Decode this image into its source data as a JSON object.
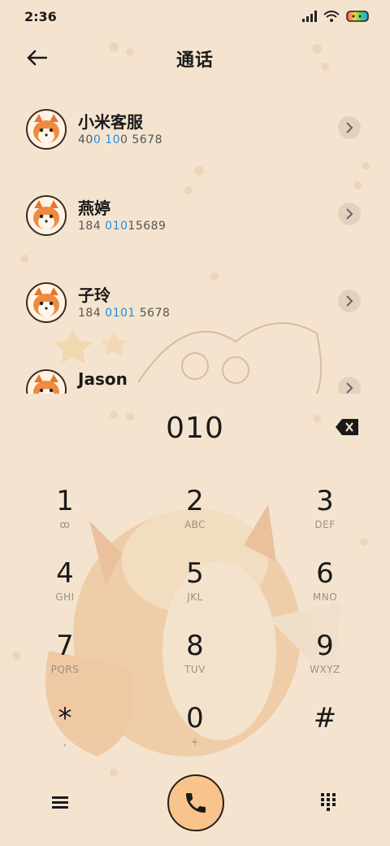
{
  "status": {
    "time": "2:36"
  },
  "header": {
    "title": "通话"
  },
  "contacts": [
    {
      "name": "小米客服",
      "num_pre": "40",
      "num_hl": "0 10",
      "num_post": "0 5678"
    },
    {
      "name": "燕婷",
      "num_pre": "184 ",
      "num_hl": "010",
      "num_post": "15689"
    },
    {
      "name": "子玲",
      "num_pre": "184 ",
      "num_hl": "0101",
      "num_post": " 5678"
    },
    {
      "name": "Jason",
      "num_pre": "",
      "num_hl": "",
      "num_post": ""
    }
  ],
  "dialer": {
    "input": "010",
    "keys": [
      {
        "digit": "1",
        "letters": "ꝏ"
      },
      {
        "digit": "2",
        "letters": "ABC"
      },
      {
        "digit": "3",
        "letters": "DEF"
      },
      {
        "digit": "4",
        "letters": "GHI"
      },
      {
        "digit": "5",
        "letters": "JKL"
      },
      {
        "digit": "6",
        "letters": "MNO"
      },
      {
        "digit": "7",
        "letters": "PQRS"
      },
      {
        "digit": "8",
        "letters": "TUV"
      },
      {
        "digit": "9",
        "letters": "WXYZ"
      },
      {
        "digit": "*",
        "letters": ","
      },
      {
        "digit": "0",
        "letters": "+"
      },
      {
        "digit": "#",
        "letters": ""
      }
    ]
  },
  "colors": {
    "accent": "#1f8fe6",
    "call": "#f8c48c",
    "background": "#f4e4cf"
  }
}
